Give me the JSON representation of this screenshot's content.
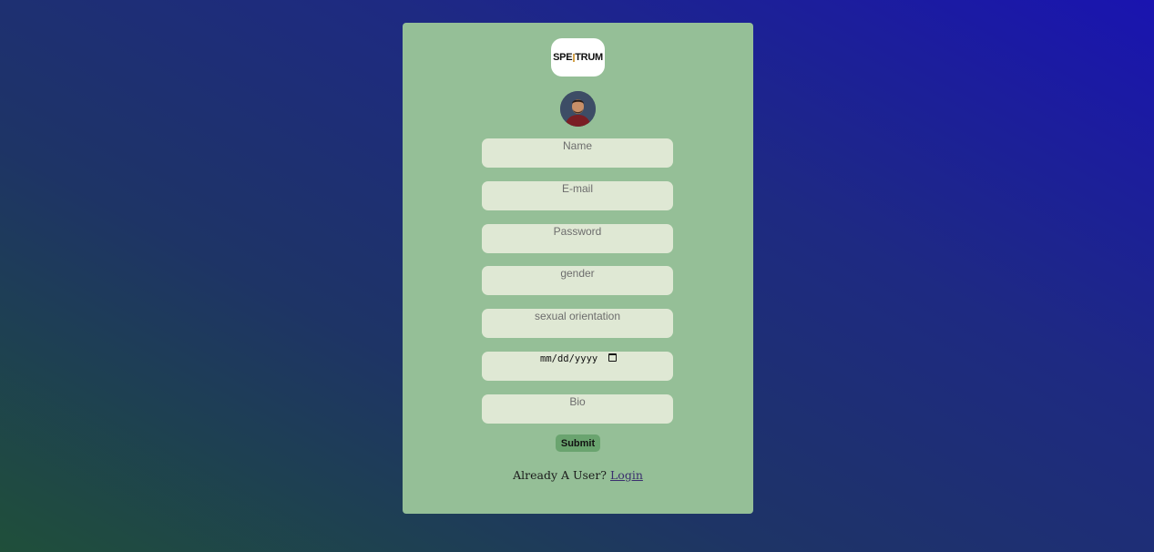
{
  "brand": {
    "logo_text_left": "SPE",
    "logo_text_right": "TRUM"
  },
  "form": {
    "name_placeholder": "Name",
    "email_placeholder": "E-mail",
    "password_placeholder": "Password",
    "gender_placeholder": "gender",
    "orientation_placeholder": "sexual orientation",
    "date_placeholder": "mm/dd/yyyy",
    "bio_placeholder": "Bio",
    "submit_label": "Submit"
  },
  "footer": {
    "already_text": "Already A User?",
    "login_label": "Login"
  },
  "icons": [
    "calendar-icon",
    "avatar"
  ],
  "colors": {
    "card_bg": "#95bf97",
    "field_bg": "#dfe8d4",
    "submit_bg": "#6aa46f"
  }
}
